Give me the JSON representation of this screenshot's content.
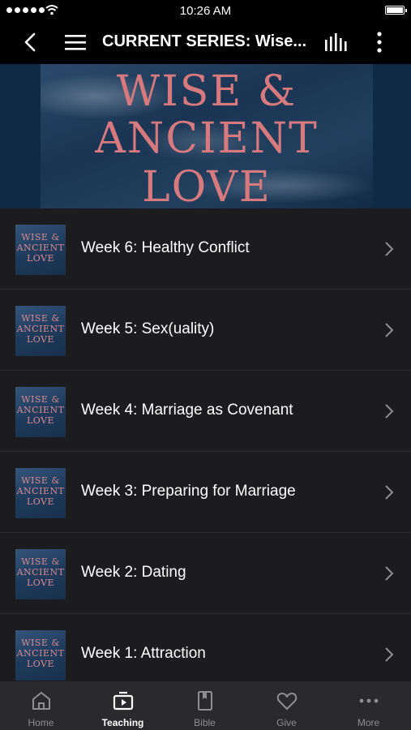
{
  "status_bar": {
    "time": "10:26 AM"
  },
  "nav": {
    "title": "CURRENT SERIES: Wise..."
  },
  "banner": {
    "line1": "WISE &",
    "line2": "ANCIENT",
    "line3": "LOVE"
  },
  "thumb_text": {
    "line1": "WISE &",
    "line2": "ANCIENT",
    "line3": "LOVE"
  },
  "list": {
    "items": [
      {
        "label": "Week 6: Healthy Conflict"
      },
      {
        "label": "Week 5: Sex(uality)"
      },
      {
        "label": "Week 4: Marriage as Covenant"
      },
      {
        "label": "Week 3: Preparing for Marriage"
      },
      {
        "label": "Week 2: Dating"
      },
      {
        "label": "Week 1: Attraction"
      }
    ]
  },
  "tabs": [
    {
      "label": "Home",
      "icon": "home-icon"
    },
    {
      "label": "Teaching",
      "icon": "play-tv-icon",
      "active": true
    },
    {
      "label": "Bible",
      "icon": "bible-icon"
    },
    {
      "label": "Give",
      "icon": "heart-icon"
    },
    {
      "label": "More",
      "icon": "more-horizontal-icon"
    }
  ],
  "colors": {
    "accent_text": "#d67a7e",
    "background": "#1c1c1e",
    "tab_bar": "#2a2a2c"
  }
}
